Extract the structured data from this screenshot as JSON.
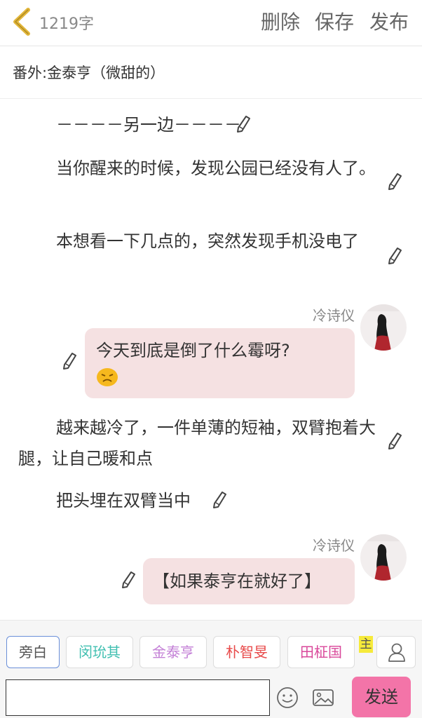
{
  "header": {
    "word_count": "1219字",
    "delete_label": "删除",
    "save_label": "保存",
    "publish_label": "发布"
  },
  "chapter": {
    "title": "番外:金泰亨（微甜的）"
  },
  "story": {
    "p1": "－－－－另一边－－－－",
    "p2": "当你醒来的时候，发现公园已经没有人了。",
    "p3": "本想看一下几点的，突然发现手机没电了",
    "msg1": {
      "speaker": "冷诗仪",
      "text": "今天到底是倒了什么霉呀?"
    },
    "p4": "越来越冷了，一件单薄的短袖，双臂抱着大腿，让自己暖和点",
    "p5": "把头埋在双臂当中",
    "msg2": {
      "speaker": "冷诗仪",
      "text": "【如果泰亨在就好了】"
    }
  },
  "roles": {
    "items": [
      {
        "label": "旁白",
        "color": "#666666"
      },
      {
        "label": "闵玧其",
        "color": "#3fbfb0"
      },
      {
        "label": "金泰亨",
        "color": "#c37fd6"
      },
      {
        "label": "朴智旻",
        "color": "#e84a4a"
      },
      {
        "label": "田柾国",
        "color": "#d9479a"
      }
    ],
    "main_badge": "主"
  },
  "composer": {
    "input_value": "",
    "send_label": "发送"
  },
  "icons": [
    "back-chevron-icon",
    "pencil-icon",
    "sad-emoji-icon",
    "user-icon",
    "emoji-icon",
    "image-icon"
  ],
  "colors": {
    "bubble": "#f5e1e2",
    "send": "#f374a8",
    "back": "#e2b63a",
    "badge": "#f6ea3a"
  }
}
